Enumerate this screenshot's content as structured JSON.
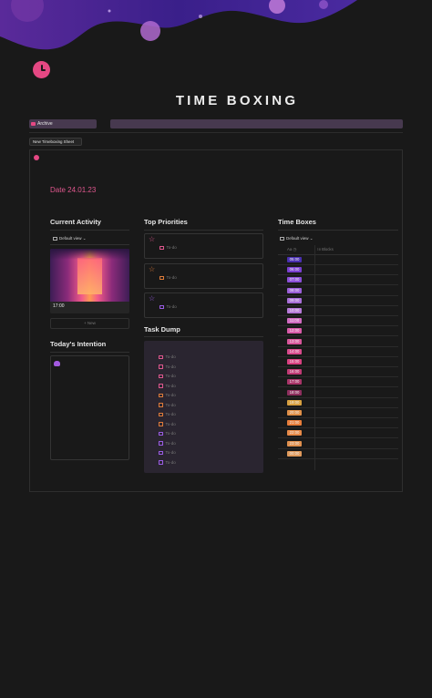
{
  "page": {
    "title": "TIME BOXING",
    "archive_label": "Archive",
    "new_sheet_label": "New Timeboxing Sheet",
    "date": "Date 24.01.23"
  },
  "current_activity": {
    "title": "Current Activity",
    "view": "Default view",
    "card_time": "17:00",
    "new_label": "+ New"
  },
  "intention": {
    "title": "Today's Intention"
  },
  "priorities": {
    "title": "Top Priorities",
    "items": [
      {
        "todo": "To-do",
        "color": "#e0578e",
        "icon": "star-outline-icon"
      },
      {
        "todo": "To-do",
        "color": "#e07c3a",
        "icon": "star-outline-icon"
      },
      {
        "todo": "To-do",
        "color": "#9b5de5",
        "icon": "star-outline-icon"
      }
    ]
  },
  "task_dump": {
    "title": "Task Dump",
    "items": [
      {
        "todo": "To-do",
        "color": "#e0578e"
      },
      {
        "todo": "To-do",
        "color": "#e0578e"
      },
      {
        "todo": "To-do",
        "color": "#e0578e"
      },
      {
        "todo": "To-do",
        "color": "#e0578e"
      },
      {
        "todo": "To-do",
        "color": "#e07c3a"
      },
      {
        "todo": "To-do",
        "color": "#e07c3a"
      },
      {
        "todo": "To-do",
        "color": "#e07c3a"
      },
      {
        "todo": "To-do",
        "color": "#e07c3a"
      },
      {
        "todo": "To-do",
        "color": "#9b5de5"
      },
      {
        "todo": "To-do",
        "color": "#9b5de5"
      },
      {
        "todo": "To-do",
        "color": "#9b5de5"
      },
      {
        "todo": "To-do",
        "color": "#9b5de5"
      }
    ]
  },
  "time_boxes": {
    "title": "Time Boxes",
    "view": "Default view",
    "col_name": "Aa",
    "col_blocks": "Blocks",
    "rows": [
      {
        "time": "05:00",
        "color": "#4a2fb0"
      },
      {
        "time": "06:00",
        "color": "#7a3fd0"
      },
      {
        "time": "07:00",
        "color": "#8b4fd8"
      },
      {
        "time": "08:00",
        "color": "#9a5ed8"
      },
      {
        "time": "09:00",
        "color": "#a86ed8"
      },
      {
        "time": "10:00",
        "color": "#b679d8"
      },
      {
        "time": "11:00",
        "color": "#d06ac0"
      },
      {
        "time": "12:00",
        "color": "#d85aa8"
      },
      {
        "time": "13:00",
        "color": "#d8559a"
      },
      {
        "time": "14:00",
        "color": "#d84a8c"
      },
      {
        "time": "15:00",
        "color": "#d84080"
      },
      {
        "time": "16:00",
        "color": "#c03a74"
      },
      {
        "time": "17:00",
        "color": "#a83468"
      },
      {
        "time": "18:00",
        "color": "#8e2f5e"
      },
      {
        "time": "19:00",
        "color": "#d8a040"
      },
      {
        "time": "20:00",
        "color": "#e09048"
      },
      {
        "time": "21:00",
        "color": "#e87d3a"
      },
      {
        "time": "22:00",
        "color": "#e88a48"
      },
      {
        "time": "23:00",
        "color": "#e0904e"
      },
      {
        "time": "00:00",
        "color": "#e09a5c"
      }
    ]
  },
  "colors": {
    "accent": "#e54883",
    "archive_bg": "#47394f",
    "page_bg": "#191919"
  }
}
